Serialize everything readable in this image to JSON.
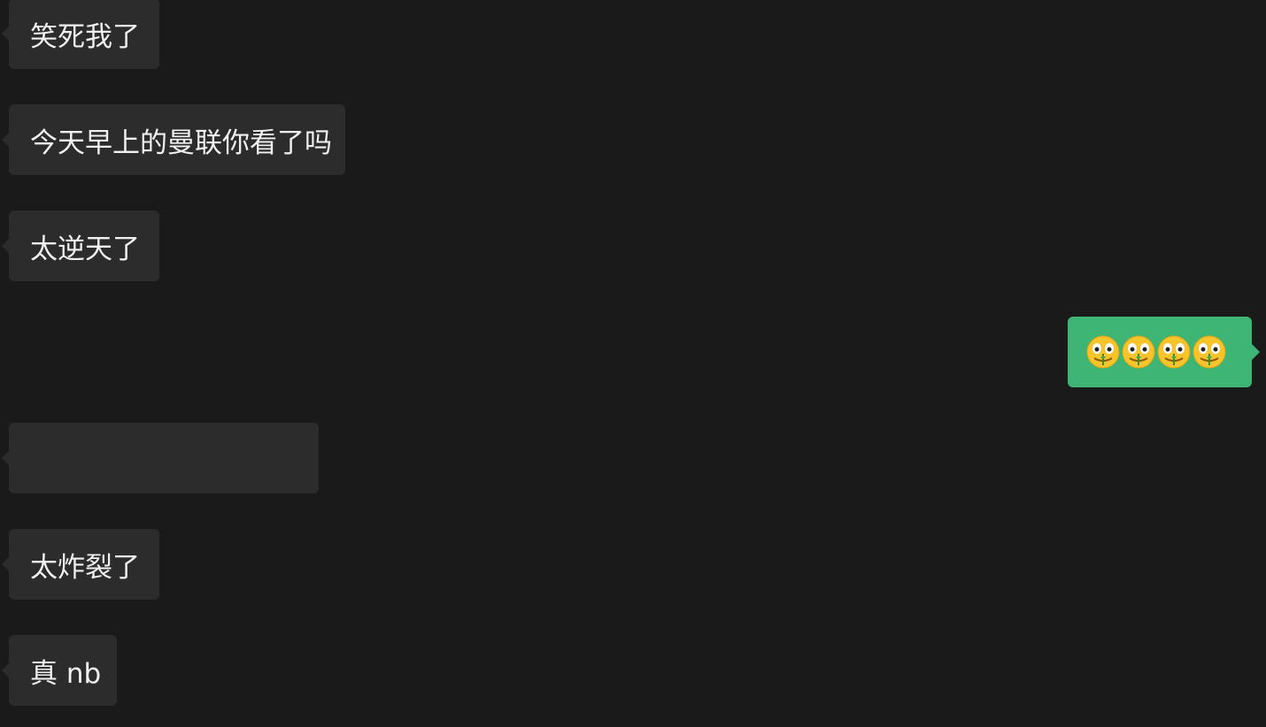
{
  "colors": {
    "background": "#1a1a1a",
    "incoming_bubble": "#2c2c2c",
    "outgoing_bubble": "#3eb575",
    "text": "#f0f0f0"
  },
  "messages": [
    {
      "direction": "incoming",
      "text": "笑死我了"
    },
    {
      "direction": "incoming",
      "text": "今天早上的曼联你看了吗"
    },
    {
      "direction": "incoming",
      "text": "太逆天了"
    },
    {
      "direction": "outgoing",
      "emoji": "money-mouth-face-icon",
      "emoji_count": 4
    },
    {
      "direction": "incoming",
      "text": ""
    },
    {
      "direction": "incoming",
      "text": "太炸裂了"
    },
    {
      "direction": "incoming",
      "text": "真 nb"
    }
  ]
}
